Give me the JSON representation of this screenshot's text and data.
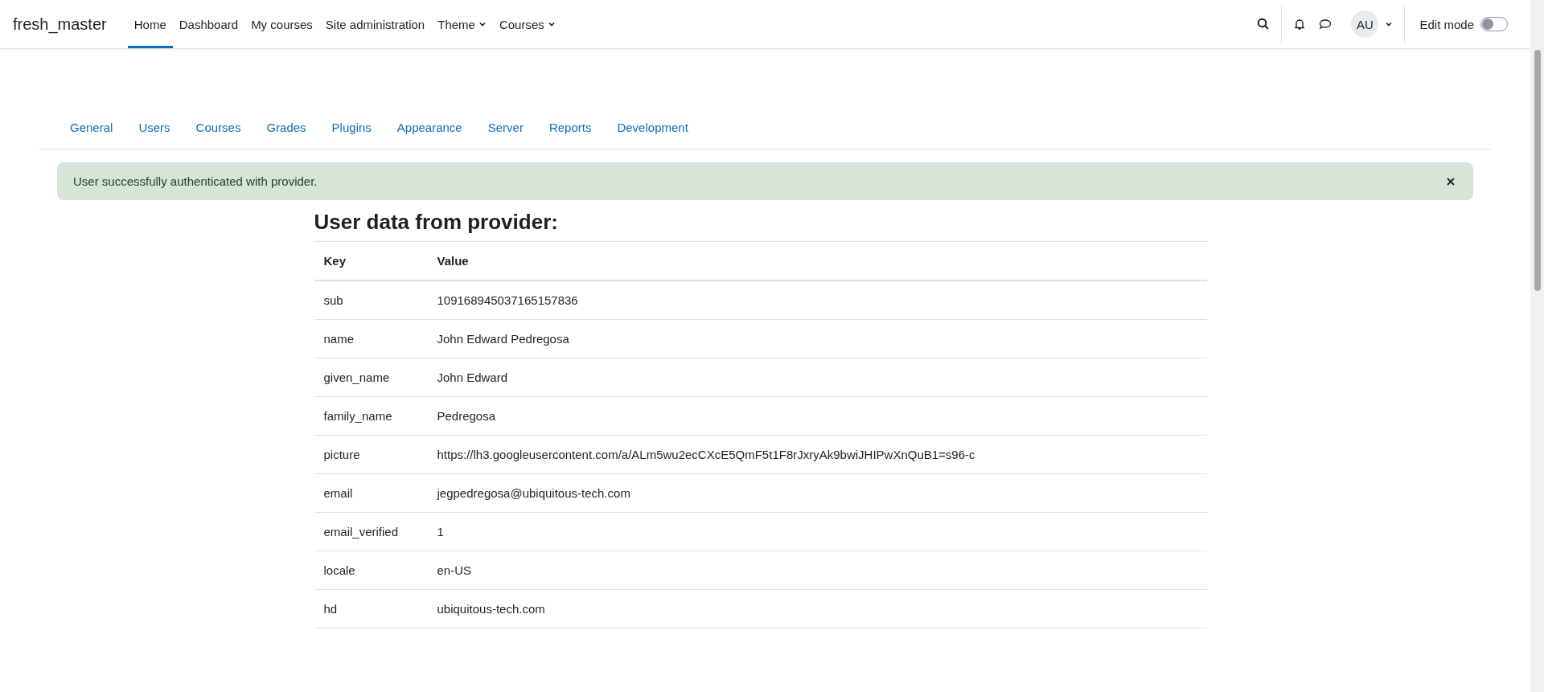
{
  "navbar": {
    "brand": "fresh_master",
    "items": [
      {
        "label": "Home",
        "selected": true,
        "dropdown": false
      },
      {
        "label": "Dashboard",
        "selected": false,
        "dropdown": false
      },
      {
        "label": "My courses",
        "selected": false,
        "dropdown": false
      },
      {
        "label": "Site administration",
        "selected": false,
        "dropdown": false
      },
      {
        "label": "Theme",
        "selected": false,
        "dropdown": true
      },
      {
        "label": "Courses",
        "selected": false,
        "dropdown": true
      }
    ],
    "avatar": "AU",
    "edit_mode": {
      "label": "Edit mode",
      "on": false
    }
  },
  "admin_tabs": [
    {
      "label": "General"
    },
    {
      "label": "Users"
    },
    {
      "label": "Courses"
    },
    {
      "label": "Grades"
    },
    {
      "label": "Plugins"
    },
    {
      "label": "Appearance"
    },
    {
      "label": "Server"
    },
    {
      "label": "Reports"
    },
    {
      "label": "Development"
    }
  ],
  "alert": {
    "message": "User successfully authenticated with provider."
  },
  "heading": "User data from provider:",
  "table": {
    "columns": [
      "Key",
      "Value"
    ],
    "rows": [
      [
        "sub",
        "109168945037165157836"
      ],
      [
        "name",
        "John Edward Pedregosa"
      ],
      [
        "given_name",
        "John Edward"
      ],
      [
        "family_name",
        "Pedregosa"
      ],
      [
        "picture",
        "https://lh3.googleusercontent.com/a/ALm5wu2ecCXcE5QmF5t1F8rJxryAk9bwiJHIPwXnQuB1=s96-c"
      ],
      [
        "email",
        "jegpedregosa@ubiquitous-tech.com"
      ],
      [
        "email_verified",
        "1"
      ],
      [
        "locale",
        "en-US"
      ],
      [
        "hd",
        "ubiquitous-tech.com"
      ]
    ]
  }
}
